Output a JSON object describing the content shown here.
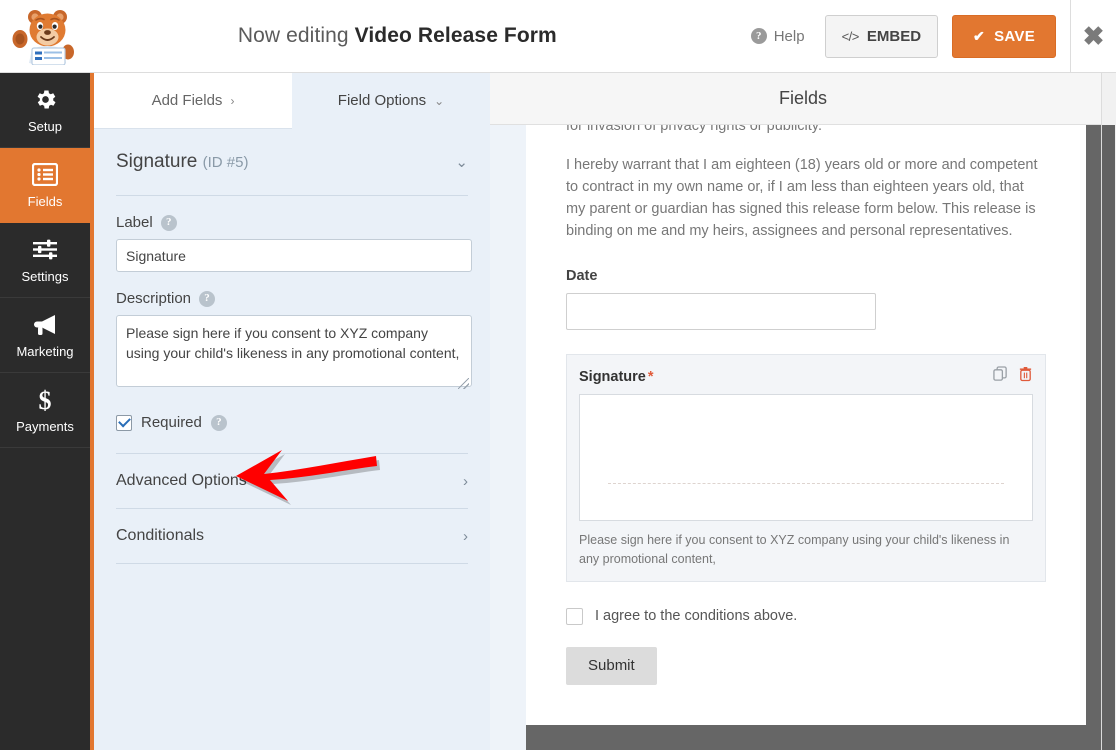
{
  "header": {
    "logo_alt": "wpforms-bear-logo",
    "title_lead": "Now editing",
    "title_strong": "Video Release Form",
    "help_label": "Help",
    "embed_label": "EMBED",
    "embed_icon_text": "</>",
    "save_label": "SAVE",
    "save_icon": "✔",
    "close_icon": "✖",
    "accent_color": "#e27730"
  },
  "sidebar": {
    "items": [
      {
        "label": "Setup",
        "icon": "gear-icon",
        "active": false
      },
      {
        "label": "Fields",
        "icon": "list-icon",
        "active": true
      },
      {
        "label": "Settings",
        "icon": "sliders-icon",
        "active": false
      },
      {
        "label": "Marketing",
        "icon": "megaphone-icon",
        "active": false
      },
      {
        "label": "Payments",
        "icon": "dollar-icon",
        "active": false
      }
    ]
  },
  "fields_bar": {
    "title": "Fields"
  },
  "panel": {
    "tabs": [
      {
        "label": "Add Fields",
        "chevron": "›",
        "active": false
      },
      {
        "label": "Field Options",
        "chevron": "⌄",
        "active": true
      }
    ],
    "field_header": {
      "name": "Signature",
      "id": "(ID #5)",
      "chevron": "⌄"
    },
    "label_option": {
      "label": "Label",
      "help_icon": "?",
      "value": "Signature"
    },
    "description_option": {
      "label": "Description",
      "help_icon": "?",
      "value": "Please sign here if you consent to XYZ company using your child's likeness in any promotional content,"
    },
    "required_option": {
      "label": "Required",
      "help_icon": "?",
      "checked": true
    },
    "accordions": [
      {
        "label": "Advanced Options",
        "chevron": "›"
      },
      {
        "label": "Conditionals",
        "chevron": "›"
      }
    ]
  },
  "annotation": {
    "type": "red-arrow",
    "points_to": "Required checkbox",
    "color": "#ff0000"
  },
  "preview": {
    "paragraphs": [
      "for invasion of privacy rights or publicity.",
      "I hereby warrant that I am eighteen (18) years old or more and competent to contract in my own name or, if I am less than eighteen years old, that my parent or guardian has signed this release form below. This release is binding on me and my heirs, assignees and personal representatives."
    ],
    "date_field": {
      "label": "Date",
      "value": ""
    },
    "signature_field": {
      "label": "Signature",
      "required_mark": "*",
      "description": "Please sign here if you consent to XYZ company using your child's likeness in any promotional content,",
      "duplicate_icon": "copy-icon",
      "delete_icon": "trash-icon",
      "required_color": "#e05a3a"
    },
    "agree_checkbox": {
      "label": "I agree to the conditions above.",
      "checked": false
    },
    "submit_label": "Submit"
  }
}
